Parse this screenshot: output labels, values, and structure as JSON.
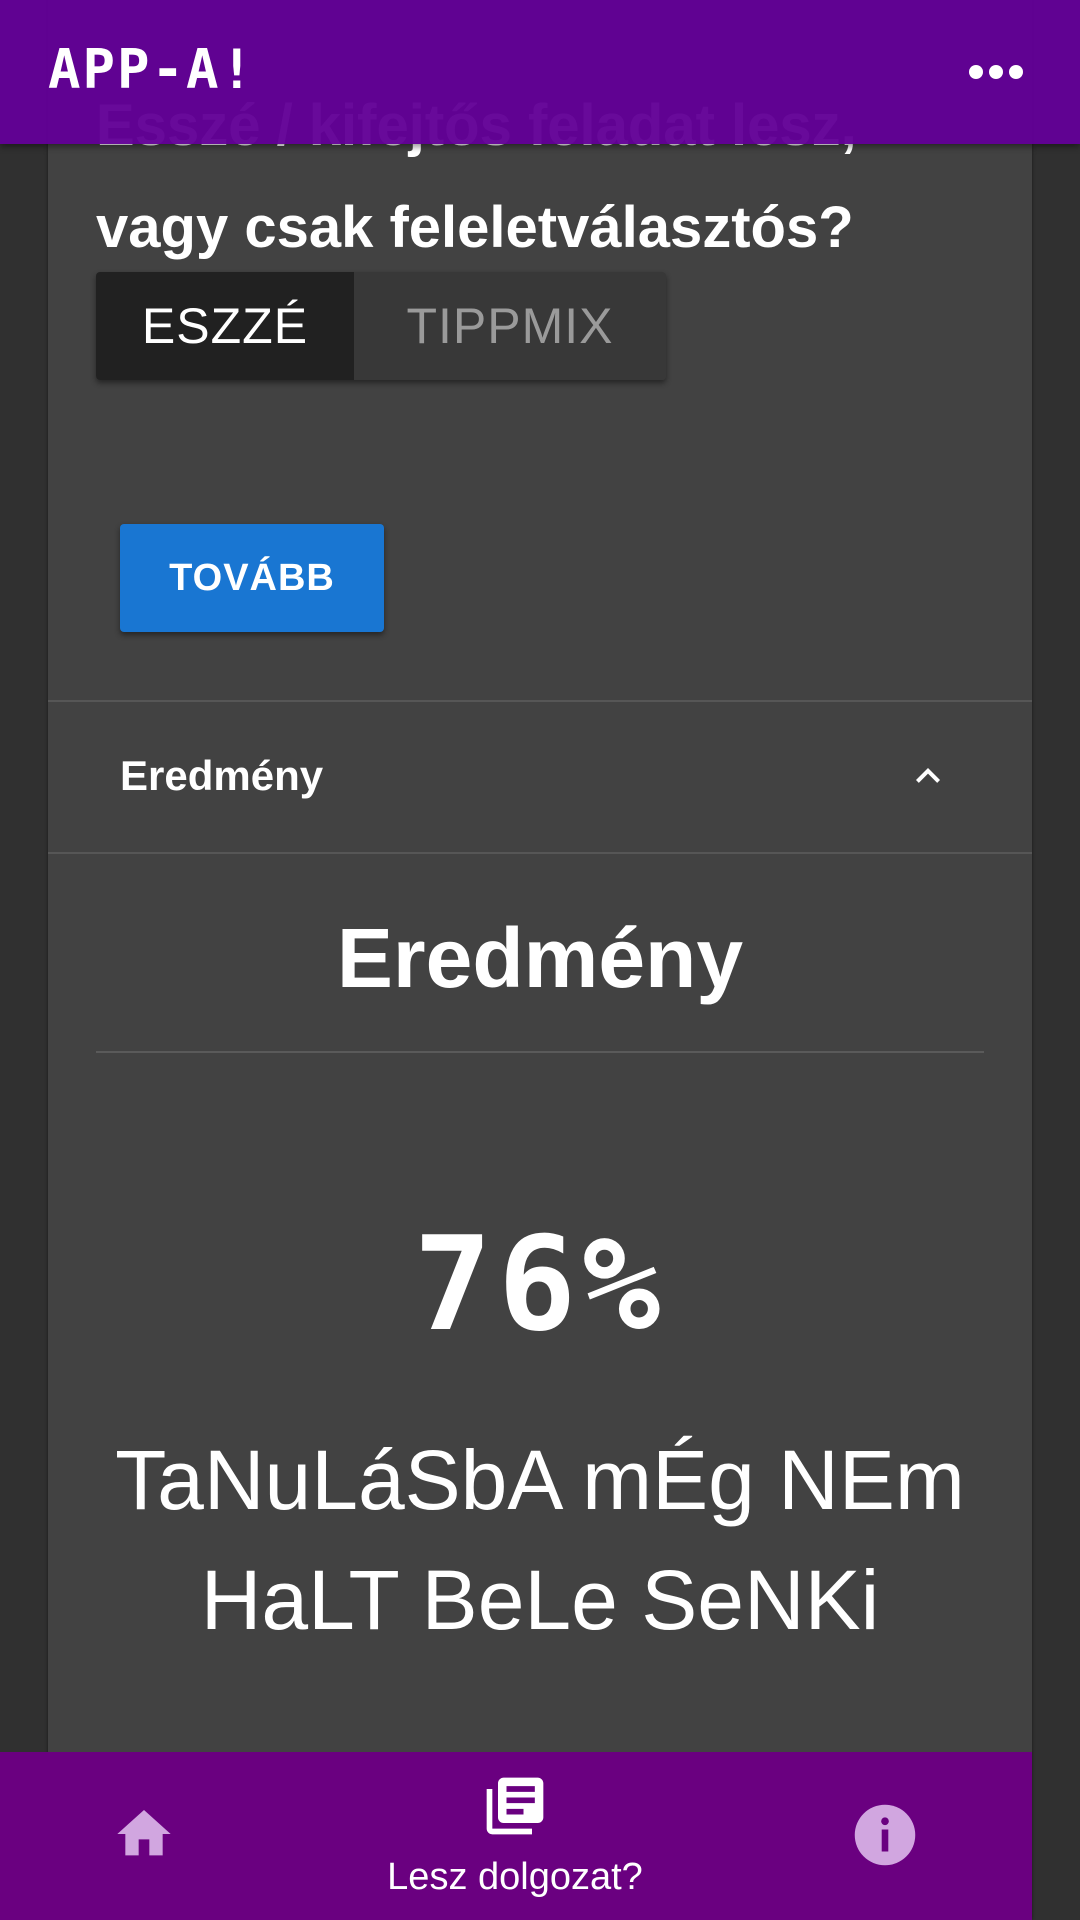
{
  "app": {
    "title": "APP-A!",
    "more_icon": "more-horiz-icon"
  },
  "question": {
    "text": "Esszé / kifejtős feladat lesz, vagy csak feleletválasztós?"
  },
  "toggle": {
    "options": [
      {
        "label": "ESZZÉ",
        "selected": true
      },
      {
        "label": "TIPPMIX",
        "selected": false
      }
    ]
  },
  "next_button": {
    "label": "TOVÁBB"
  },
  "panel": {
    "header_label": "Eredmény",
    "chevron_icon": "chevron-up-icon",
    "expanded": true
  },
  "result": {
    "title": "Eredmény",
    "percent_text": "76%",
    "percent_value": 76,
    "message": "TaNuLáSbA mÉg NEm HaLT BeLe SeNKi"
  },
  "bottom_nav": {
    "items": [
      {
        "icon": "home-icon",
        "label": ""
      },
      {
        "icon": "library-books-icon",
        "label": "Lesz dolgozat?",
        "active": true
      },
      {
        "icon": "info-icon",
        "label": ""
      }
    ]
  },
  "colors": {
    "app_bar": "#620096",
    "bottom_nav": "#6a0080",
    "background": "#303030",
    "card": "#424242",
    "primary_button": "#1976d2",
    "nav_icon_inactive": "#d1a6e0"
  }
}
